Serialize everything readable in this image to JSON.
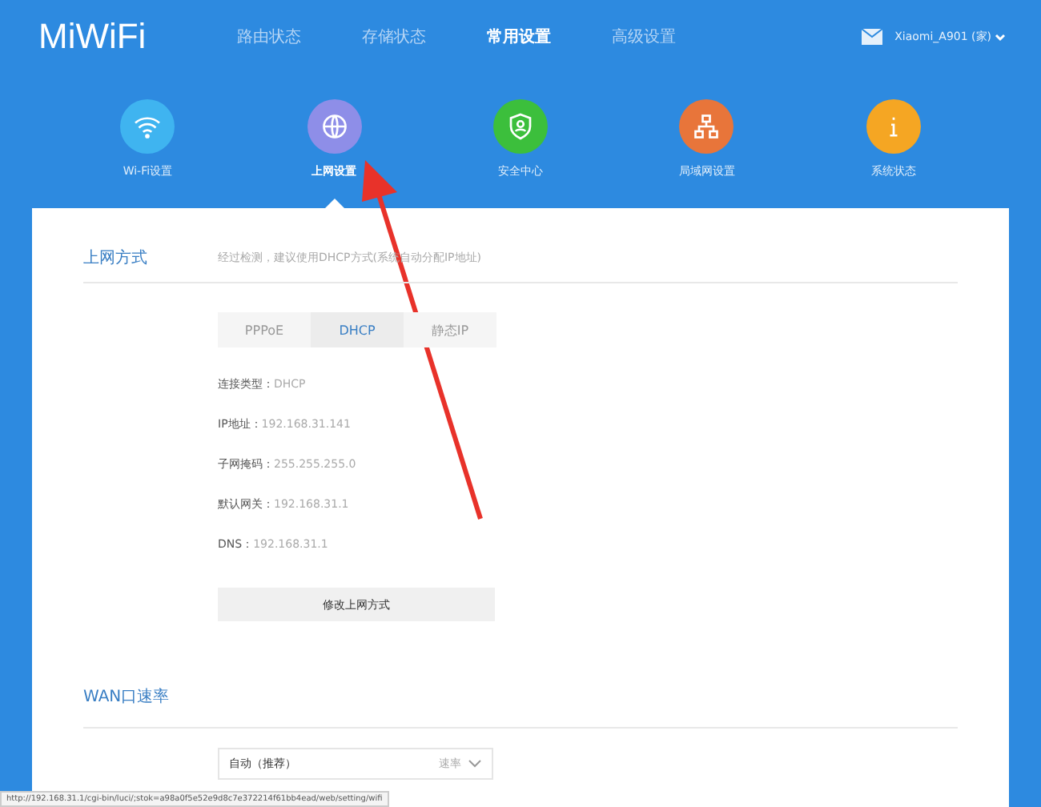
{
  "header": {
    "logo": "MiWiFi",
    "nav": [
      {
        "label": "路由状态",
        "selected": false
      },
      {
        "label": "存储状态",
        "selected": false
      },
      {
        "label": "常用设置",
        "selected": true
      },
      {
        "label": "高级设置",
        "selected": false
      }
    ],
    "user": "Xiaomi_A901 (家)"
  },
  "shortcuts": [
    {
      "kind": "wifi",
      "label": "Wi-Fi设置",
      "color": "#3fb4f0",
      "selected": false
    },
    {
      "kind": "globe",
      "label": "上网设置",
      "color": "#8e8ee8",
      "selected": true
    },
    {
      "kind": "shield",
      "label": "安全中心",
      "color": "#3cbf3c",
      "selected": false
    },
    {
      "kind": "network",
      "label": "局域网设置",
      "color": "#e8753a",
      "selected": false
    },
    {
      "kind": "info",
      "label": "系统状态",
      "color": "#f5a623",
      "selected": false
    }
  ],
  "internet": {
    "title": "上网方式",
    "hint": "经过检测，建议使用DHCP方式(系统自动分配IP地址)",
    "modes": [
      {
        "label": "PPPoE",
        "selected": false
      },
      {
        "label": "DHCP",
        "selected": true
      },
      {
        "label": "静态IP",
        "selected": false
      }
    ],
    "info": [
      {
        "label": "连接类型：",
        "value": "DHCP"
      },
      {
        "label": "IP地址：",
        "value": "192.168.31.141"
      },
      {
        "label": "子网掩码：",
        "value": "255.255.255.0"
      },
      {
        "label": "默认网关：",
        "value": "192.168.31.1"
      },
      {
        "label": "DNS：",
        "value": "192.168.31.1"
      }
    ],
    "button": "修改上网方式"
  },
  "wan": {
    "title": "WAN口速率",
    "select_value": "自动（推荐）",
    "select_hint": "速率"
  },
  "status_url": "http://192.168.31.1/cgi-bin/luci/;stok=a98a0f5e52e9d8c7e372214f61bb4ead/web/setting/wifi"
}
